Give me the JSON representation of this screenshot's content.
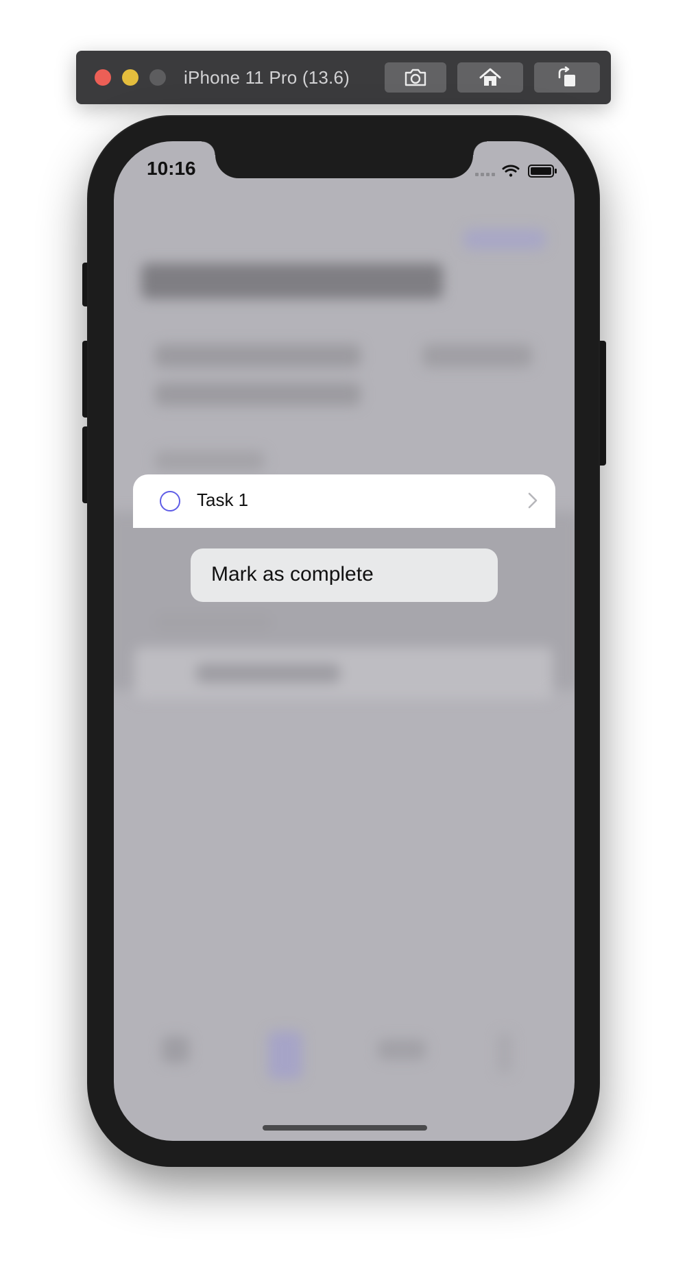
{
  "simulator": {
    "title": "iPhone 11 Pro (13.6)",
    "toolbar": {
      "screenshot_icon": "camera-icon",
      "home_icon": "home-icon",
      "rotate_icon": "rotate-icon"
    }
  },
  "status_bar": {
    "time": "10:16",
    "icons": [
      "signal-icon",
      "wifi-icon",
      "battery-icon"
    ]
  },
  "context_preview": {
    "task_label": "Task 1",
    "checkbox_color": "#5e5ce6"
  },
  "context_menu": {
    "items": [
      {
        "label": "Mark as complete"
      }
    ]
  },
  "colors": {
    "accent": "#5e5ce6",
    "dim_background": "#b4b3b9",
    "menu_background": "#e8e9ea"
  }
}
